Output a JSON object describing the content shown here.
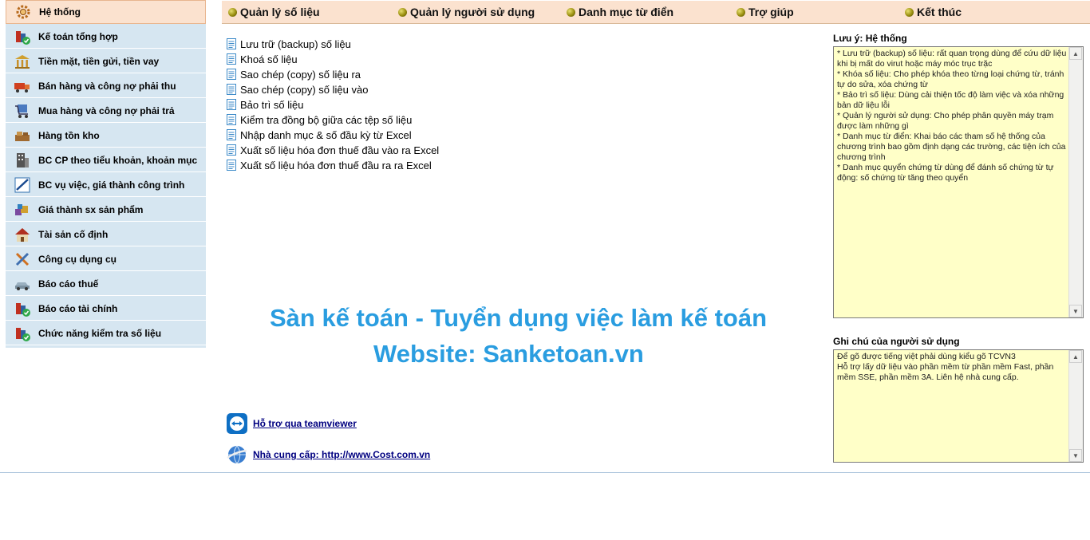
{
  "sidebar": {
    "items": [
      {
        "label": "Hệ thống",
        "icon": "gear-icon"
      },
      {
        "label": "Kế toán tổng hợp",
        "icon": "ledger-icon"
      },
      {
        "label": "Tiền mặt, tiền gửi, tiền vay",
        "icon": "bank-icon"
      },
      {
        "label": "Bán hàng và công nợ phải thu",
        "icon": "truck-icon"
      },
      {
        "label": "Mua hàng và công nợ phải trả",
        "icon": "cart-icon"
      },
      {
        "label": "Hàng tồn kho",
        "icon": "warehouse-icon"
      },
      {
        "label": "BC CP theo tiểu khoản, khoản mục",
        "icon": "building-icon"
      },
      {
        "label": "BC vụ việc, giá thành công trình",
        "icon": "chart-pencil-icon"
      },
      {
        "label": "Giá thành sx sản phẩm",
        "icon": "products-icon"
      },
      {
        "label": "Tài sản cố định",
        "icon": "house-icon"
      },
      {
        "label": "Công cụ dụng cụ",
        "icon": "tools-icon"
      },
      {
        "label": "Báo cáo thuế",
        "icon": "car-icon"
      },
      {
        "label": "Báo cáo tài chính",
        "icon": "finance-report-icon"
      },
      {
        "label": "Chức năng kiểm tra số liệu",
        "icon": "check-data-icon"
      }
    ]
  },
  "menu": {
    "items": [
      {
        "label": "Quản lý số liệu"
      },
      {
        "label": "Quản lý người sử dụng"
      },
      {
        "label": "Danh mục từ điển"
      },
      {
        "label": "Trợ giúp"
      },
      {
        "label": "Kết thúc"
      }
    ]
  },
  "functions": [
    "Lưu trữ (backup) số liệu",
    "Khoá số liệu",
    "Sao chép (copy) số liệu ra",
    "Sao chép (copy) số liệu vào",
    "Bảo trì số liệu",
    "Kiểm tra đồng bộ giữa các tệp số liệu",
    "Nhập danh mục & số đầu kỳ từ Excel",
    "Xuất số liệu hóa đơn thuế đầu vào ra Excel",
    "Xuất số liệu hóa đơn thuế đầu ra ra Excel"
  ],
  "watermark": {
    "line1": "Sàn kế toán - Tuyển dụng việc làm kế toán",
    "line2": "Website:  Sanketoan.vn"
  },
  "links": {
    "teamviewer": "Hỗ trợ qua teamviewer",
    "provider": "Nhà cung cấp: http://www.Cost.com.vn"
  },
  "notes_panel": {
    "title": "Lưu ý: Hệ thống",
    "text": "* Lưu trữ (backup) số liệu: rất quan trọng dùng để cứu dữ liệu khi bị mất do virut hoặc máy móc trục trặc\n* Khóa số liệu: Cho phép khóa theo từng loại chứng từ, tránh tự do sửa, xóa chứng từ\n* Bảo trì số liệu: Dùng cải thiện tốc độ làm việc và xóa những bản dữ liệu lỗi\n* Quản lý người sử dụng: Cho phép phân quyền máy trạm được làm những gì\n* Danh mục từ điển: Khai báo các tham số hệ thống của chương trình bao gồm định dạng các trường, các tiện ích của chương trình\n* Danh mục quyển chứng từ dùng để đánh số chứng từ tự động: số chứng từ tăng theo quyển"
  },
  "user_notes_panel": {
    "title": "Ghi chú của người sử dụng",
    "text": "Để gõ được tiếng việt phải dùng kiểu gõ TCVN3\nHỗ trợ lấy dữ liệu vào phần mềm từ phần mềm Fast, phần mềm SSE, phần mềm 3A. Liên hệ nhà cung cấp."
  },
  "colors": {
    "sidebar_bg": "#d6e6f1",
    "menu_bg": "#fbe2cf",
    "note_bg": "#ffffc8",
    "watermark": "#2a9de0",
    "link": "#000080"
  }
}
